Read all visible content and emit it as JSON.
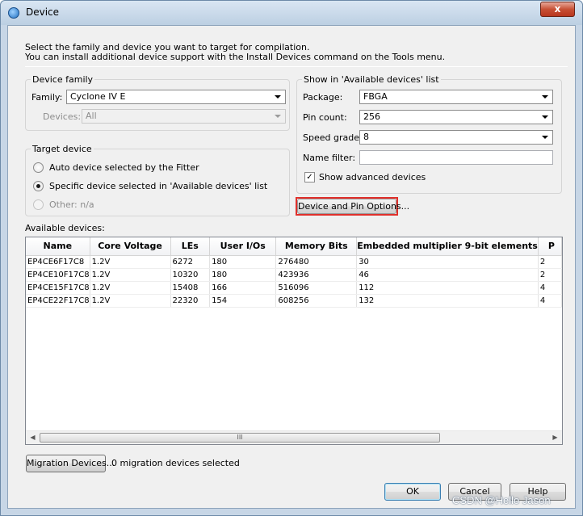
{
  "window": {
    "title": "Device",
    "close_glyph": "x"
  },
  "intro": {
    "line1": "Select the family and device you want to target for compilation.",
    "line2": "You can install additional device support with the Install Devices command on the Tools menu."
  },
  "device_family": {
    "title": "Device family",
    "family_label": "Family:",
    "family_value": "Cyclone IV E",
    "devices_label": "Devices:",
    "devices_value": "All"
  },
  "target_device": {
    "title": "Target device",
    "auto_label": "Auto device selected by the Fitter",
    "specific_label": "Specific device selected in 'Available devices' list",
    "other_label": "Other:  n/a",
    "selected": "specific"
  },
  "show_in": {
    "title": "Show in 'Available devices' list",
    "package_label": "Package:",
    "package_value": "FBGA",
    "pin_count_label": "Pin count:",
    "pin_count_value": "256",
    "speed_grade_label": "Speed grade:",
    "speed_grade_value": "8",
    "name_filter_label": "Name filter:",
    "name_filter_value": "",
    "show_advanced_label": "Show advanced devices",
    "show_advanced_checked": true
  },
  "device_pin_options_label": "Device and Pin Options...",
  "available_devices": {
    "label": "Available devices:",
    "columns": [
      "Name",
      "Core Voltage",
      "LEs",
      "User I/Os",
      "Memory Bits",
      "Embedded multiplier 9-bit elements",
      "P"
    ],
    "rows": [
      [
        "EP4CE6F17C8",
        "1.2V",
        "6272",
        "180",
        "276480",
        "30",
        "2"
      ],
      [
        "EP4CE10F17C8",
        "1.2V",
        "10320",
        "180",
        "423936",
        "46",
        "2"
      ],
      [
        "EP4CE15F17C8",
        "1.2V",
        "15408",
        "166",
        "516096",
        "112",
        "4"
      ],
      [
        "EP4CE22F17C8",
        "1.2V",
        "22320",
        "154",
        "608256",
        "132",
        "4"
      ]
    ],
    "scroll_thumb_glyph": "III"
  },
  "migration": {
    "button_label": "Migration Devices...",
    "status": "0 migration devices selected"
  },
  "buttons": {
    "ok": "OK",
    "cancel": "Cancel",
    "help": "Help"
  },
  "watermark": "CSDN @Hello Jason"
}
